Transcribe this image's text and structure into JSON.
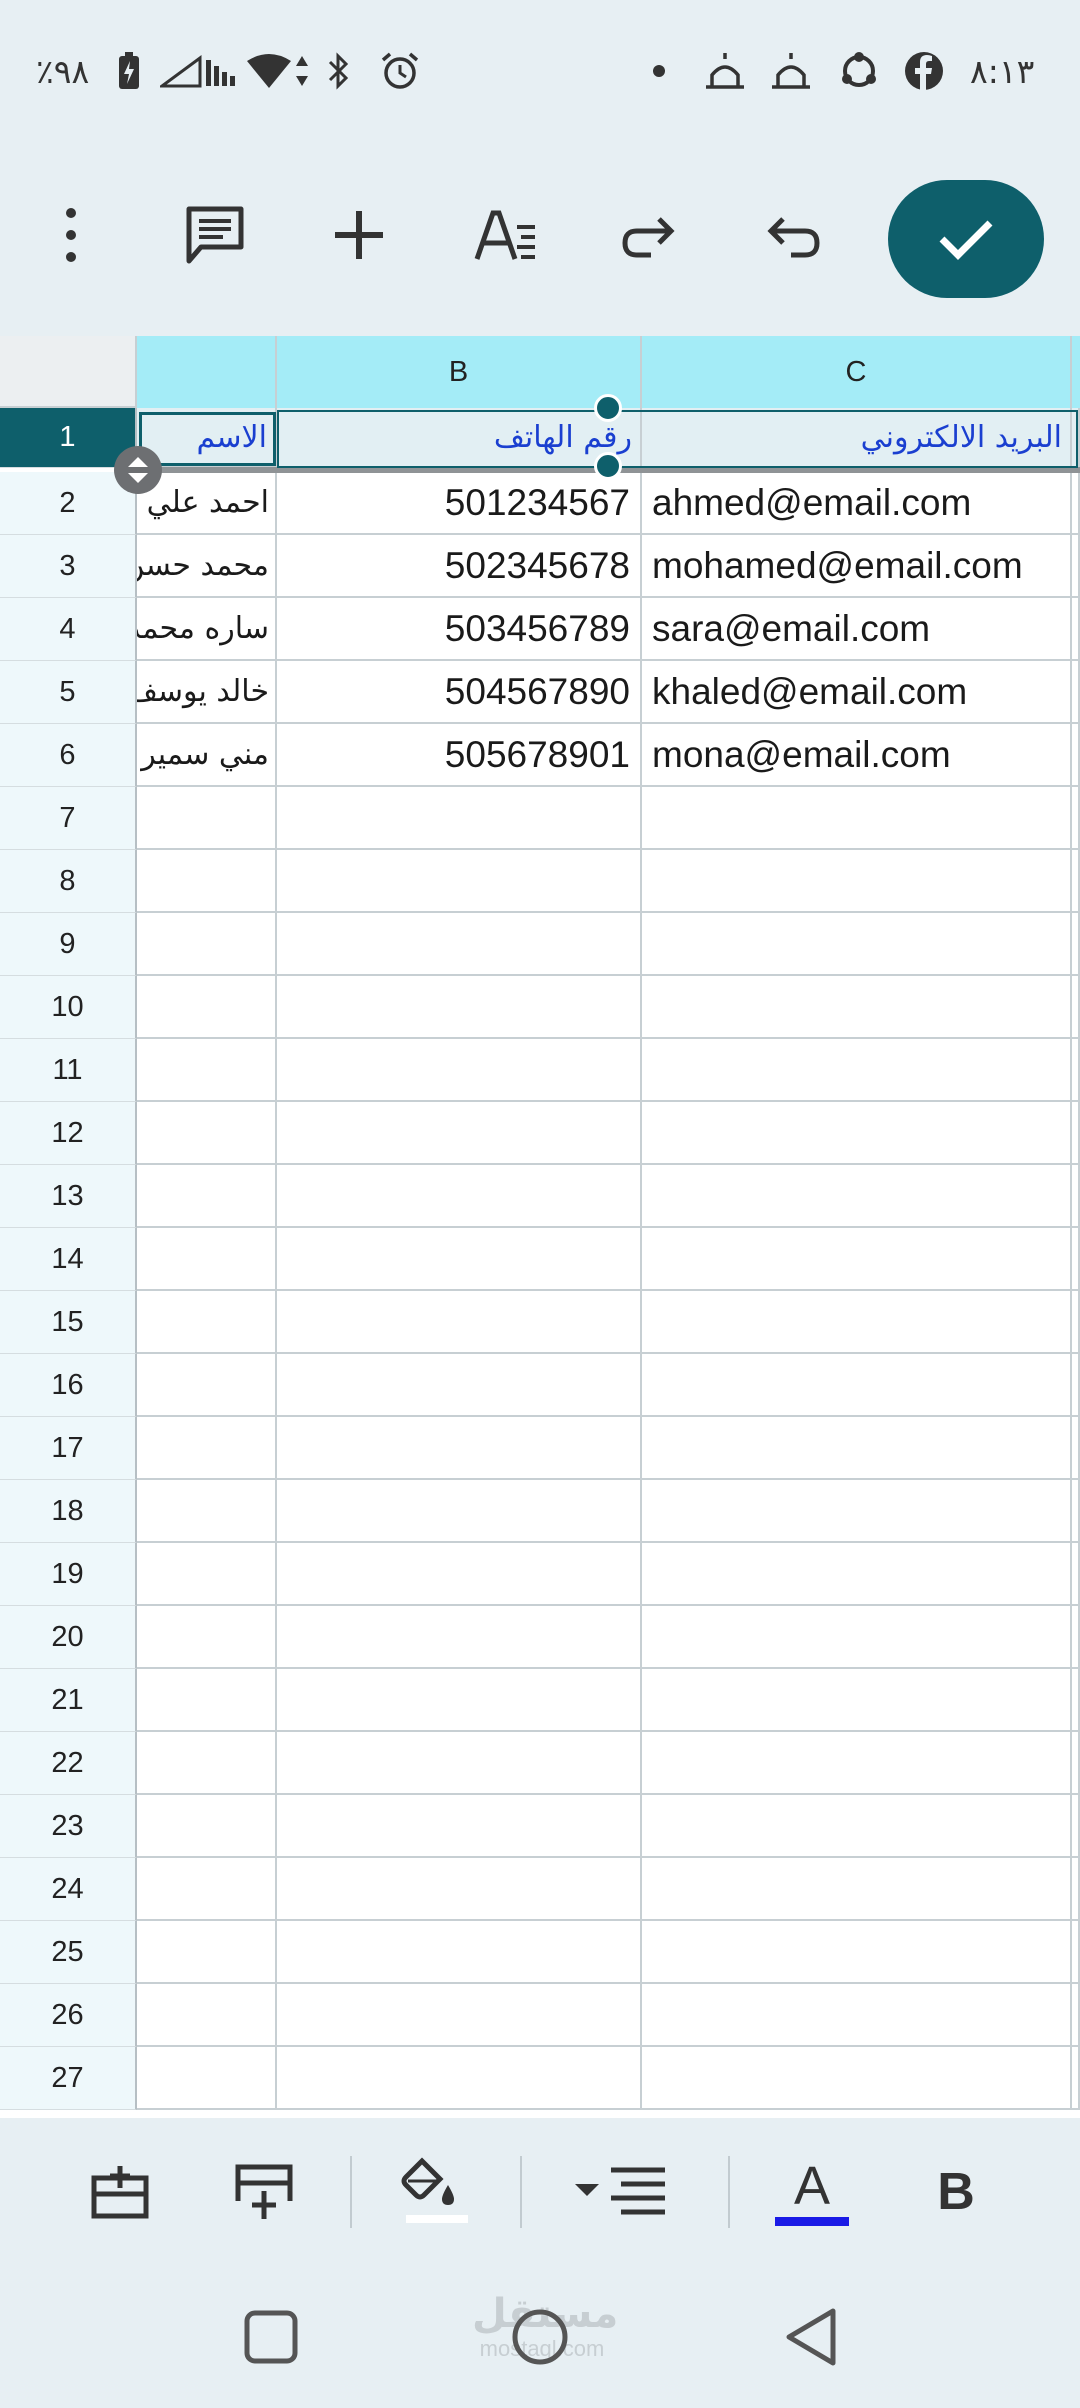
{
  "status_bar": {
    "time": "٨:١٣",
    "battery": "٪٩٨",
    "icons_right": [
      "facebook-icon",
      "sync-icon",
      "mosque-icon",
      "mosque-icon",
      "dot-icon"
    ],
    "icons_left": [
      "alarm-icon",
      "bluetooth-icon",
      "data-arrows-icon",
      "wifi-icon",
      "signal-icon",
      "signal-icon",
      "battery-icon"
    ]
  },
  "toolbar": {
    "buttons": [
      "more-vert-icon",
      "comment-icon",
      "add-icon",
      "text-format-icon",
      "redo-icon",
      "undo-icon"
    ],
    "confirm": "check-icon",
    "accent_color": "#0e5f6b"
  },
  "sheet": {
    "columns": [
      "",
      "B",
      "C"
    ],
    "row_numbers": [
      "1",
      "2",
      "3",
      "4",
      "5",
      "6",
      "7",
      "8",
      "9",
      "10",
      "11",
      "12",
      "13",
      "14",
      "15",
      "16",
      "17",
      "18",
      "19",
      "20",
      "21",
      "22",
      "23",
      "24",
      "25",
      "26",
      "27"
    ],
    "header_row": [
      "الاسم",
      "رقم الهاتف",
      "البريد الالكتروني"
    ],
    "rows": [
      [
        "احمد علي",
        "501234567",
        "ahmed@email.com"
      ],
      [
        "محمد حسن",
        "502345678",
        "mohamed@email.com"
      ],
      [
        "ساره محمد",
        "503456789",
        "sara@email.com"
      ],
      [
        "خالد يوسف",
        "504567890",
        "khaled@email.com"
      ],
      [
        "مني سمير",
        "505678901",
        "mona@email.com"
      ]
    ],
    "header_text_color": "#1a3fd0",
    "column_header_color": "#a4ecf7"
  },
  "format_bar": {
    "buttons": [
      "insert-row-above-icon",
      "insert-row-below-icon",
      "fill-color-icon",
      "align-icon",
      "text-color-icon",
      "bold-icon"
    ],
    "text_color_swatch": "#1a1ae6",
    "bold_label": "B",
    "text_color_label": "A"
  },
  "nav_bar": {
    "buttons": [
      "recents-icon",
      "home-icon",
      "back-icon"
    ],
    "watermark_arabic": "مستقل",
    "watermark_latin": "mostaql.com"
  }
}
